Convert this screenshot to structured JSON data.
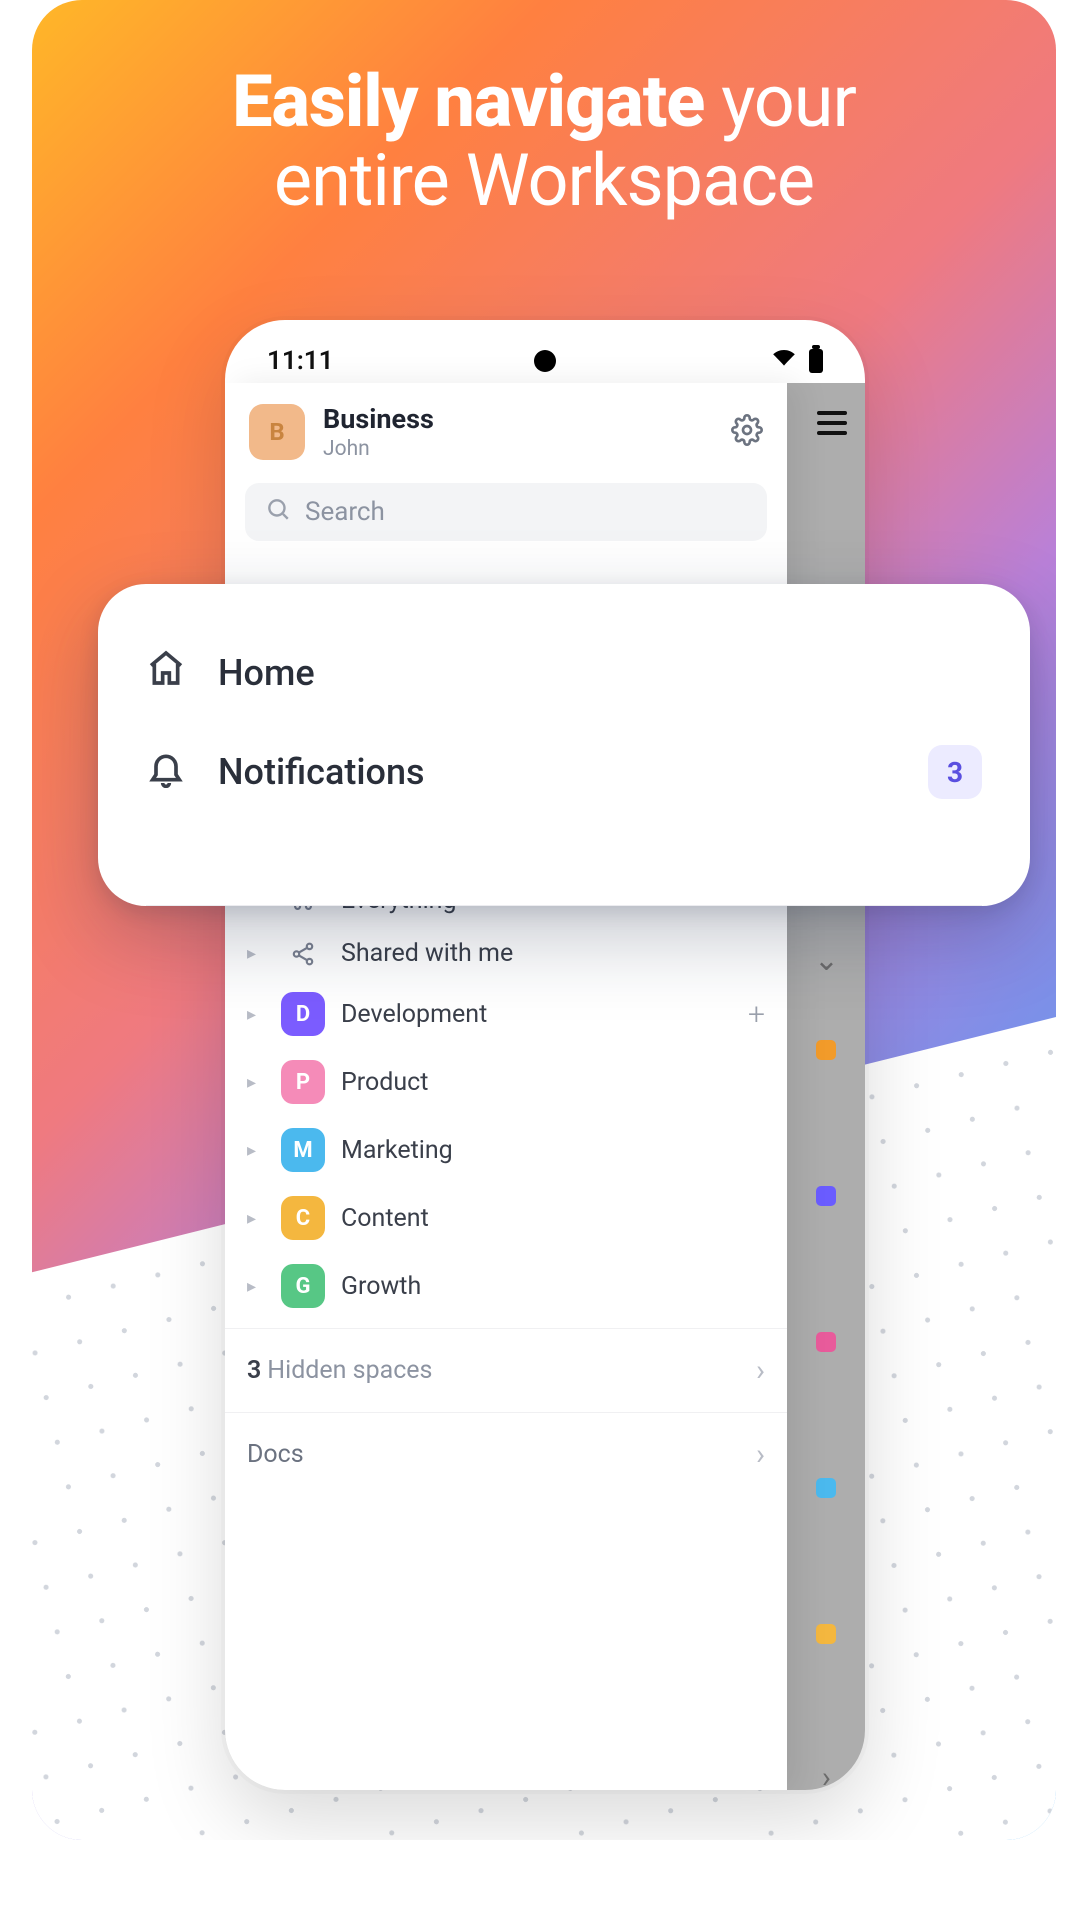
{
  "promo": {
    "headline_bold": "Easily navigate",
    "headline_rest_1": " your",
    "headline_line2": "entire Workspace"
  },
  "status": {
    "time": "11:11"
  },
  "workspace": {
    "avatar_letter": "B",
    "title": "Business",
    "user": "John"
  },
  "search": {
    "placeholder": "Search"
  },
  "popover": {
    "home_label": "Home",
    "notifications_label": "Notifications",
    "notifications_count": "3"
  },
  "spaces_header": {
    "everything_label": "Everything",
    "shared_label": "Shared with me"
  },
  "spaces": [
    {
      "letter": "D",
      "label": "Development",
      "color": "#7b5cff",
      "show_add": true
    },
    {
      "letter": "P",
      "label": "Product",
      "color": "#f58bb8",
      "show_add": false
    },
    {
      "letter": "M",
      "label": "Marketing",
      "color": "#4bb9ee",
      "show_add": false
    },
    {
      "letter": "C",
      "label": "Content",
      "color": "#f4b73f",
      "show_add": false
    },
    {
      "letter": "G",
      "label": "Growth",
      "color": "#57c785",
      "show_add": false
    }
  ],
  "hidden_spaces": {
    "count": "3",
    "label": "Hidden spaces"
  },
  "docs": {
    "label": "Docs"
  },
  "bg_colors": [
    "#f29b2a",
    "#6a5cff",
    "#e85b9b",
    "#4bb9ee",
    "#f4b73f"
  ]
}
